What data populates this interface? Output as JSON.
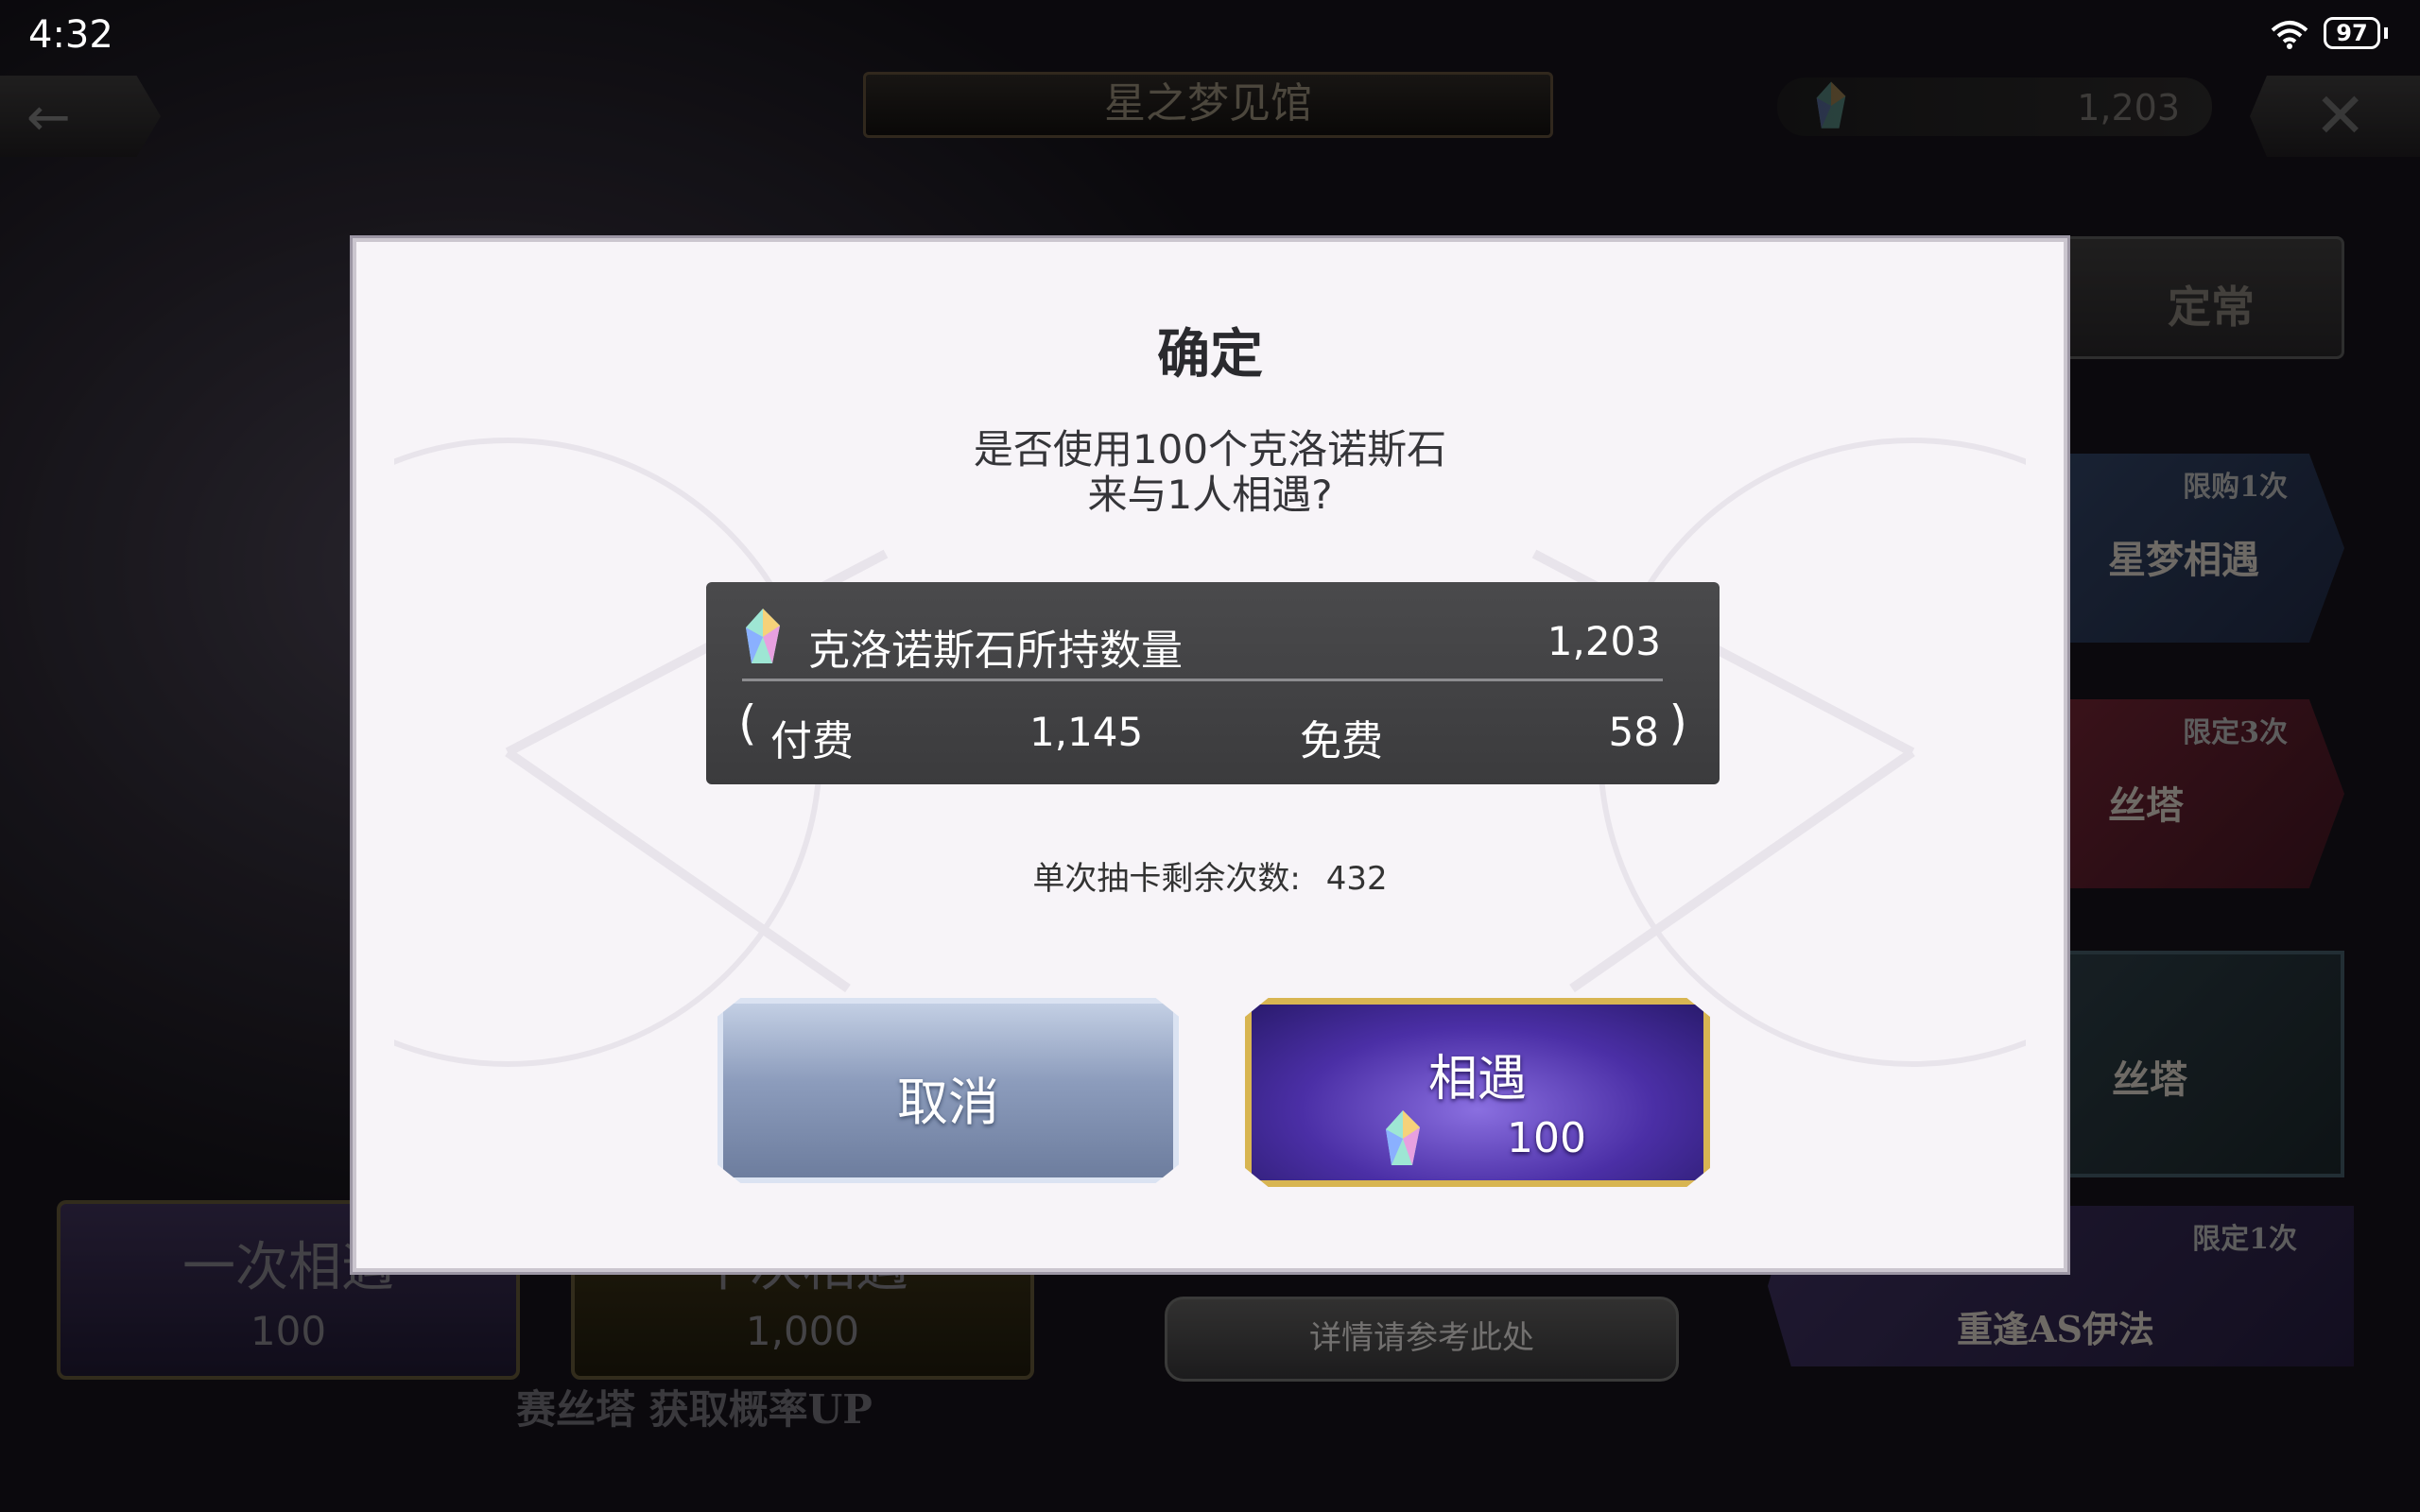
{
  "status": {
    "time": "4:32",
    "battery": "97",
    "signal": "6"
  },
  "header": {
    "title": "星之梦见馆",
    "currency": "1,203"
  },
  "right_banners": [
    {
      "tag": "",
      "text": "定常"
    },
    {
      "tag": "限购1次",
      "text": "星梦相遇"
    },
    {
      "tag": "限定3次",
      "text": "丝塔"
    },
    {
      "tag": "",
      "text": "丝塔"
    },
    {
      "tag": "限定1次",
      "text": "重逢AS伊法"
    }
  ],
  "bottom": {
    "single_label": "一次相遇",
    "single_cost": "100",
    "ten_label": "十次相遇",
    "ten_cost": "1,000",
    "detail_button": "详情请参考此处",
    "rate_up_text": "赛丝塔 获取概率UP"
  },
  "dialog": {
    "title": "确定",
    "message_line1": "是否使用100个克洛诺斯石",
    "message_line2": "来与1人相遇?",
    "balance": {
      "label": "克洛诺斯石所持数量",
      "total": "1,203",
      "paid_label": "付费",
      "paid_value": "1,145",
      "free_label": "免费",
      "free_value": "58"
    },
    "remaining_label": "单次抽卡剩余次数:",
    "remaining_value": "432",
    "cancel_label": "取消",
    "confirm_label": "相遇",
    "confirm_cost": "100"
  },
  "colors": {
    "dialog_bg": "#f7f4f8",
    "balance_box": "#404042",
    "confirm_border": "#d8b552",
    "confirm_fill": "#4b2fa6",
    "cancel_fill": "#8c9cbc"
  },
  "icons": [
    "back-arrow-icon",
    "close-icon",
    "crystal-icon",
    "wifi-icon",
    "battery-icon"
  ]
}
